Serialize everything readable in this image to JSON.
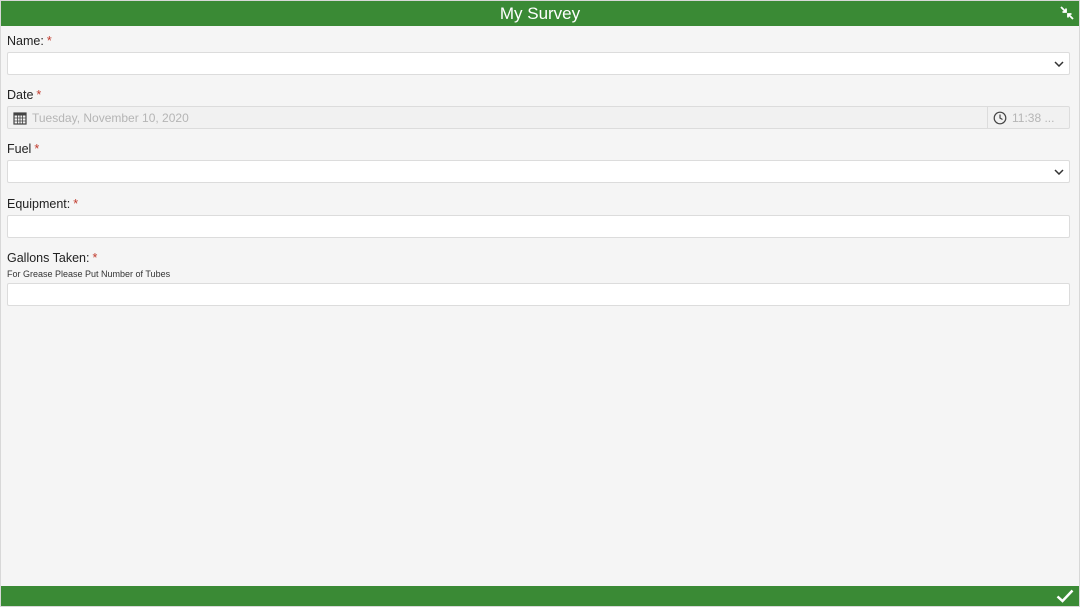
{
  "header": {
    "title": "My Survey",
    "collapse_icon": "collapse-arrows-icon"
  },
  "footer": {
    "submit_icon": "checkmark-icon"
  },
  "colors": {
    "bar": "#3a8a35",
    "required": "#c0392b"
  },
  "form": {
    "name": {
      "label": "Name:",
      "required_mark": "*",
      "value": ""
    },
    "date": {
      "label": "Date",
      "required_mark": "*",
      "date_value": "Tuesday, November 10, 2020",
      "time_value": "11:38 ..."
    },
    "fuel": {
      "label": "Fuel",
      "required_mark": "*",
      "value": ""
    },
    "equipment": {
      "label": "Equipment:",
      "required_mark": "*",
      "value": ""
    },
    "gallons": {
      "label": "Gallons Taken:",
      "required_mark": "*",
      "hint": "For Grease Please Put Number of Tubes",
      "value": ""
    }
  }
}
